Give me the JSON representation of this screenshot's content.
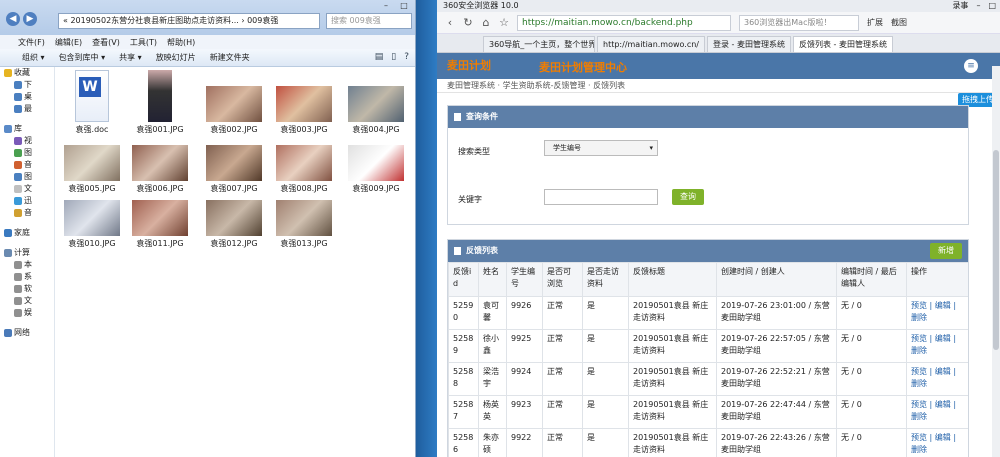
{
  "explorer": {
    "address": "« 20190502东营分社袁县新庄图助点走访资料... › 009袁强",
    "search_placeholder": "搜索 009袁强",
    "menu": [
      "文件(F)",
      "编辑(E)",
      "查看(V)",
      "工具(T)",
      "帮助(H)"
    ],
    "toolbar": [
      "组织 ▾",
      "包含到库中 ▾",
      "共享 ▾",
      "放映幻灯片",
      "新建文件夹"
    ],
    "sidebar": [
      "收藏",
      "下",
      "桌",
      "最",
      "库",
      "视",
      "图",
      "音",
      "图",
      "文",
      "迅",
      "音",
      "家庭",
      "计算",
      "本",
      "系",
      "软",
      "文",
      "娱",
      "网络"
    ],
    "files": [
      "袁强.doc",
      "袁强001.JPG",
      "袁强002.JPG",
      "袁强003.JPG",
      "袁强004.JPG",
      "袁强005.JPG",
      "袁强006.JPG",
      "袁强007.JPG",
      "袁强008.JPG",
      "袁强009.JPG",
      "袁强010.JPG",
      "袁强011.JPG",
      "袁强012.JPG",
      "袁强013.JPG"
    ]
  },
  "browser": {
    "title": "360安全浏览器 10.0",
    "title_right": "录事",
    "url": "https://maitian.mowo.cn/backend.php",
    "search_text": "360浏览器出Mac版啦！",
    "ext": "扩展",
    "shot": "截图",
    "tabs": [
      "360导航_一个主页，整个世界",
      "http://maitian.mowo.cn/",
      "登录 - 麦田管理系统",
      "反馈列表 - 麦田管理系统"
    ],
    "logo": "麦田计划",
    "app_title": "麦田计划管理中心",
    "breadcrumb": "麦田管理系统  ·  学生资助系统-反馈管理  ·  反馈列表",
    "upload": "拖拽上传",
    "query_panel": "查询条件",
    "search_type_label": "搜索类型",
    "search_type_value": "学生编号",
    "keyword_label": "关键字",
    "query_btn": "查询",
    "list_panel": "反馈列表",
    "add_btn": "新增",
    "columns": [
      "反馈id",
      "姓名",
      "学生编号",
      "是否可浏览",
      "是否走访资料",
      "反馈标题",
      "创建时间 / 创建人",
      "编辑时间 / 最后编辑人",
      "操作"
    ],
    "rows": [
      {
        "id": "52590",
        "name": "袁可馨",
        "sid": "9926",
        "view": "正常",
        "visit": "是",
        "title": "20190501袁县 新庄走访资料",
        "created": "2019-07-26 23:01:00 / 东营麦田助学组",
        "edited": "无 / 0",
        "op": "预览 | 编辑 | 删除"
      },
      {
        "id": "52589",
        "name": "徐小鑫",
        "sid": "9925",
        "view": "正常",
        "visit": "是",
        "title": "20190501袁县 新庄走访资料",
        "created": "2019-07-26 22:57:05 / 东营麦田助学组",
        "edited": "无 / 0",
        "op": "预览 | 编辑 | 删除"
      },
      {
        "id": "52588",
        "name": "梁浩宇",
        "sid": "9924",
        "view": "正常",
        "visit": "是",
        "title": "20190501袁县 新庄走访资料",
        "created": "2019-07-26 22:52:21 / 东营麦田助学组",
        "edited": "无 / 0",
        "op": "预览 | 编辑 | 删除"
      },
      {
        "id": "52587",
        "name": "杨英英",
        "sid": "9923",
        "view": "正常",
        "visit": "是",
        "title": "20190501袁县 新庄走访资料",
        "created": "2019-07-26 22:47:44 / 东营麦田助学组",
        "edited": "无 / 0",
        "op": "预览 | 编辑 | 删除"
      },
      {
        "id": "52586",
        "name": "朱亦硕",
        "sid": "9922",
        "view": "正常",
        "visit": "是",
        "title": "20190501袁县 新庄走访资料",
        "created": "2019-07-26 22:43:26 / 东营麦田助学组",
        "edited": "无 / 0",
        "op": "预览 | 编辑 | 删除"
      }
    ]
  }
}
